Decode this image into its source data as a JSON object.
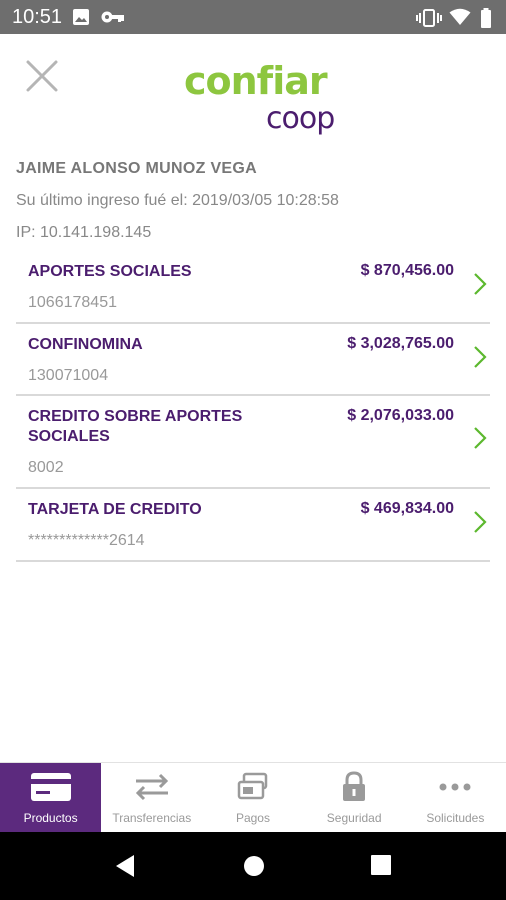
{
  "status_bar": {
    "time": "10:51",
    "left_icons": [
      "image-icon",
      "key-icon"
    ],
    "right_icons": [
      "vibrate-icon",
      "wifi-icon",
      "battery-icon"
    ]
  },
  "header": {
    "close_icon": "close-icon",
    "logo": {
      "word": "confiar",
      "sub": "coop",
      "green": "#8dc63f",
      "purple": "#4b1d6e"
    }
  },
  "user": {
    "name": "JAIME ALONSO MUNOZ VEGA",
    "last_login": "Su último ingreso fué el: 2019/03/05 10:28:58",
    "ip": "IP: 10.141.198.145"
  },
  "products": [
    {
      "name": "APORTES SOCIALES",
      "amount": "$ 870,456.00",
      "number": "1066178451"
    },
    {
      "name": "CONFINOMINA",
      "amount": "$ 3,028,765.00",
      "number": "130071004"
    },
    {
      "name": "CREDITO SOBRE APORTES SOCIALES",
      "amount": "$ 2,076,033.00",
      "number": "8002"
    },
    {
      "name": "TARJETA DE CREDITO",
      "amount": "$ 469,834.00",
      "number": "*************2614"
    }
  ],
  "bottom_nav": [
    {
      "label": "Productos",
      "icon": "card-icon",
      "active": true
    },
    {
      "label": "Transferencias",
      "icon": "transfer-icon",
      "active": false
    },
    {
      "label": "Pagos",
      "icon": "payments-icon",
      "active": false
    },
    {
      "label": "Seguridad",
      "icon": "lock-icon",
      "active": false
    },
    {
      "label": "Solicitudes",
      "icon": "more-icon",
      "active": false
    }
  ],
  "colors": {
    "accent_purple": "#5c2a7e",
    "text_purple": "#4b1d6e",
    "chevron_green": "#5cb82e",
    "logo_green": "#8dc63f"
  }
}
